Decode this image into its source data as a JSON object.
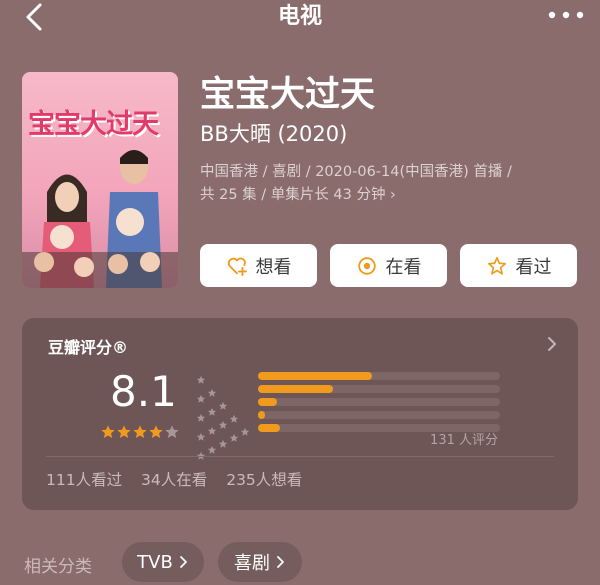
{
  "header": {
    "title": "电视"
  },
  "poster": {
    "title_text": "宝宝大过天"
  },
  "show": {
    "name": "宝宝大过天",
    "subtitle": "BB大晒 (2020)",
    "meta_line1": "中国香港 / 喜剧 / 2020-06-14(中国香港) 首播 /",
    "meta_line2": "共 25 集 / 单集片长 43 分钟 ›"
  },
  "actions": [
    {
      "label": "想看",
      "icon": "heart-plus-icon"
    },
    {
      "label": "在看",
      "icon": "target-circle-icon"
    },
    {
      "label": "看过",
      "icon": "star-outline-icon"
    }
  ],
  "rating": {
    "label": "豆瓣评分®",
    "score": "8.1",
    "stars_filled": 4,
    "stars_total": 5,
    "distribution": [
      {
        "stars": 5,
        "fraction": 0.47
      },
      {
        "stars": 4,
        "fraction": 0.31
      },
      {
        "stars": 3,
        "fraction": 0.08
      },
      {
        "stars": 2,
        "fraction": 0.03
      },
      {
        "stars": 1,
        "fraction": 0.09
      }
    ],
    "count_text": "131 人评分",
    "watched": "111人看过",
    "watching": "34人在看",
    "want": "235人想看"
  },
  "related": {
    "label": "相关分类",
    "tags": [
      "TVB",
      "喜剧"
    ]
  },
  "colors": {
    "background": "#8a6c6c",
    "card": "#6e5656",
    "accent": "#f09a1e"
  }
}
